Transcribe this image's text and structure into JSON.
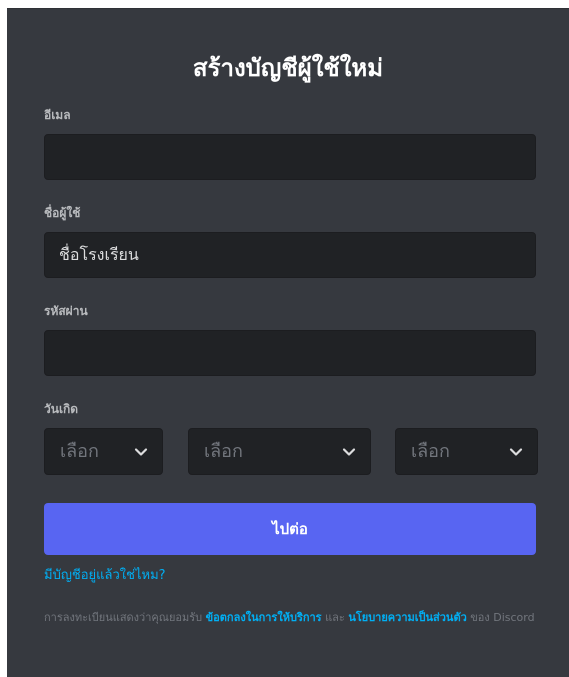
{
  "form": {
    "title": "สร้างบัญชีผู้ใช้ใหม่",
    "email": {
      "label": "อีเมล",
      "value": "",
      "placeholder": ""
    },
    "username": {
      "label": "ชื่อผู้ใช้",
      "value": "ชื่อโรงเรียน",
      "placeholder": ""
    },
    "password": {
      "label": "รหัสผ่าน",
      "value": "",
      "placeholder": ""
    },
    "birthdate": {
      "label": "วันเกิด",
      "month_placeholder": "เลือก",
      "day_placeholder": "เลือก",
      "year_placeholder": "เลือก"
    },
    "submit_label": "ไปต่อ",
    "login_link": "มีบัญชีอยู่แล้วใช่ไหม?",
    "terms": {
      "prefix": "การลงทะเบียนแสดงว่าคุณยอมรับ ",
      "tos_link": "ข้อตกลงในการให้บริการ",
      "and": " และ ",
      "privacy_link": "นโยบายความเป็นส่วนตัว",
      "suffix": " ของ Discord"
    }
  },
  "colors": {
    "background": "#36393f",
    "input_bg": "#202225",
    "accent": "#5865f2",
    "link": "#00aff4",
    "label": "#b9bbbe",
    "muted": "#72767d"
  },
  "icons": {
    "select_chevron": "chevron-down-icon"
  }
}
